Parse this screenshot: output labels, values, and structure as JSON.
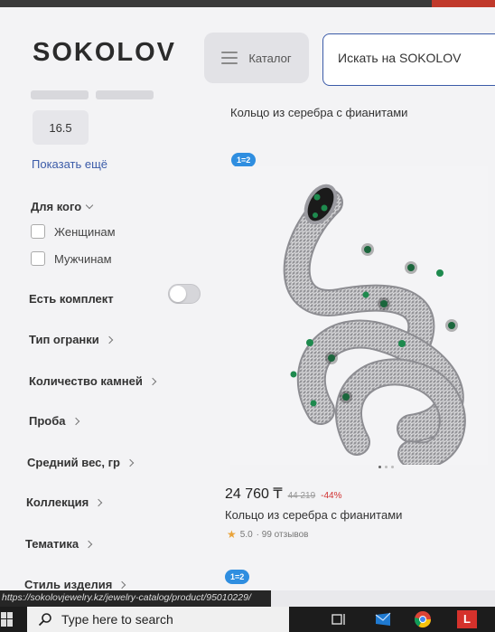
{
  "header": {
    "logo": "SOKOLOV",
    "catalog_label": "Каталог",
    "search_placeholder": "Искать на SOKOLOV"
  },
  "sidebar": {
    "size_value": "16.5",
    "show_more": "Показать ещё",
    "for_whom": {
      "title": "Для кого",
      "options": [
        "Женщинам",
        "Мужчинам"
      ]
    },
    "has_set": "Есть комплект",
    "filters": [
      "Тип огранки",
      "Количество камней",
      "Проба",
      "Средний вес, гр",
      "Коллекция",
      "Тематика",
      "Стиль изделия"
    ]
  },
  "main": {
    "top_product_title": "Кольцо из серебра с фианитами",
    "badge": "1=2",
    "product": {
      "price": "24 760 ₸",
      "old_price": "44 219",
      "discount": "-44%",
      "name": "Кольцо из серебра с фианитами",
      "rating": "5.0",
      "reviews": "· 99 отзывов"
    },
    "next_badge": "1=2"
  },
  "status_bar": {
    "url": "https://sokolovjewelry.kz/jewelry-catalog/product/95010229/"
  },
  "taskbar": {
    "search_placeholder": "Type here to search"
  },
  "colors": {
    "accent_blue": "#3b5ba8",
    "badge_blue": "#2f8ee0",
    "discount_red": "#d03030",
    "star": "#e9a339"
  }
}
